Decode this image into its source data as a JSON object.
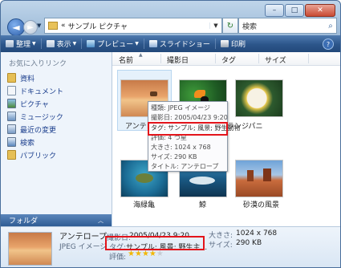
{
  "window": {
    "controls": {
      "minimize": "–",
      "maximize": "□",
      "close": "✕"
    }
  },
  "nav": {
    "back_glyph": "◄",
    "forward_glyph": "►",
    "address_chevron": "«",
    "address_path": "サンプル ピクチャ",
    "refresh_glyph": "↻",
    "search_placeholder": "検索",
    "search_glyph": "⌕"
  },
  "toolbar": {
    "organize": "整理",
    "views": "表示",
    "preview": "プレビュー",
    "slideshow": "スライドショー",
    "print": "印刷",
    "help": "?"
  },
  "sidebar": {
    "header": "お気に入りリンク",
    "items": [
      {
        "label": "資料"
      },
      {
        "label": "ドキュメント"
      },
      {
        "label": "ピクチャ"
      },
      {
        "label": "ミュージック"
      },
      {
        "label": "最近の変更"
      },
      {
        "label": "検索"
      },
      {
        "label": "パブリック"
      }
    ],
    "folder_bar": "フォルダ",
    "folder_bar_arrow": "︿"
  },
  "columns": {
    "name": "名前",
    "date": "撮影日",
    "tags": "タグ",
    "size": "サイズ",
    "sort_arrow": "▲"
  },
  "files": [
    {
      "name": "アンテロ"
    },
    {
      "name": ""
    },
    {
      "name": "ランジパニ"
    },
    {
      "name": "海緑亀"
    },
    {
      "name": "鯨"
    },
    {
      "name": "砂漠の風景"
    }
  ],
  "tooltip": {
    "type": "種類: JPEG イメージ",
    "date": "撮影日: 2005/04/23 9:20",
    "tags": "タグ: サンプル; 風景; 野生動物",
    "rating": "評価: 4 つ星",
    "dims": "大きさ: 1024 x 768",
    "size": "サイズ: 290 KB",
    "title": "タイトル: アンテロープ"
  },
  "details": {
    "name": "アンテロープ",
    "type": "JPEG イメージ",
    "date_label": "撮影日:",
    "date": "2005/04/23 9:20",
    "tags_label": "タグ:",
    "tags": "サンプル; 風景; 野生主...",
    "rating_label": "評価:",
    "dims_label": "大きさ:",
    "dims": "1024 x 768",
    "size_label": "サイズ:",
    "size": "290 KB",
    "rating_stars": 4,
    "rating_max": 5
  },
  "colors": {
    "toolbar": "#2c558a",
    "link": "#1b3e8d",
    "highlight": "#e3141b",
    "star_filled": "#f2b705"
  }
}
